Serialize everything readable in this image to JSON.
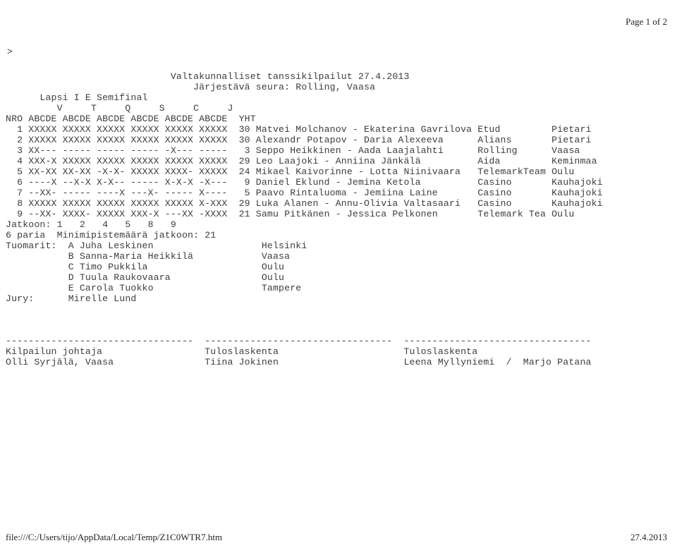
{
  "print_header": {
    "page_label": "Page 1 of 2"
  },
  "print_footer": {
    "file_path": "file:///C:/Users/tijo/AppData/Local/Temp/Z1C0WTR7.htm",
    "date": "27.4.2013"
  },
  "document": {
    "prompt_symbol": ">",
    "title_line_1": "Valtakunnalliset tanssikilpailut 27.4.2013",
    "title_line_2": "Järjestävä seura: Rolling, Vaasa",
    "event_line": "Lapsi I E Semifinal",
    "dance_header": "         V     T     Q     S     C     J",
    "column_header": "NRO ABCDE ABCDE ABCDE ABCDE ABCDE ABCDE  YHT",
    "rows": [
      {
        "nro": "1",
        "marks": "XXXXX XXXXX XXXXX XXXXX XXXXX XXXXX",
        "yht": "30",
        "couple": "Matvei Molchanov - Ekaterina Gavrilova",
        "club": "Etud",
        "city": "Pietari"
      },
      {
        "nro": "2",
        "marks": "XXXXX XXXXX XXXXX XXXXX XXXXX XXXXX",
        "yht": "30",
        "couple": "Alexandr Potapov - Daria Alexeeva",
        "club": "Alians",
        "city": "Pietari"
      },
      {
        "nro": "3",
        "marks": "XX--- ----- ----- ----- -X--- -----",
        "yht": "3",
        "couple": "Seppo Heikkinen - Aada Laajalahti",
        "club": "Rolling",
        "city": "Vaasa"
      },
      {
        "nro": "4",
        "marks": "XXX-X XXXXX XXXXX XXXXX XXXXX XXXXX",
        "yht": "29",
        "couple": "Leo Laajoki - Anniina Jänkälä",
        "club": "Aida",
        "city": "Keminmaa"
      },
      {
        "nro": "5",
        "marks": "XX-XX XX-XX -X-X- XXXXX XXXX- XXXXX",
        "yht": "24",
        "couple": "Mikael Kaivorinne - Lotta Niinivaara",
        "club": "TelemarkTeam",
        "city": "Oulu"
      },
      {
        "nro": "6",
        "marks": "----X --X-X X-X-- ----- X-X-X -X---",
        "yht": "9",
        "couple": "Daniel Eklund - Jemina Ketola",
        "club": "Casino",
        "city": "Kauhajoki"
      },
      {
        "nro": "7",
        "marks": "--XX- ----- ----X ---X- ----- X----",
        "yht": "5",
        "couple": "Paavo Rintaluoma - Jemiina Laine",
        "club": "Casino",
        "city": "Kauhajoki"
      },
      {
        "nro": "8",
        "marks": "XXXXX XXXXX XXXXX XXXXX XXXXX X-XXX",
        "yht": "29",
        "couple": "Luka Alanen - Annu-Olivia Valtasaari",
        "club": "Casino",
        "city": "Kauhajoki"
      },
      {
        "nro": "9",
        "marks": "--XX- XXXX- XXXXX XXX-X ---XX -XXXX",
        "yht": "21",
        "couple": "Samu Pitkänen - Jessica Pelkonen",
        "club": "Telemark Tea",
        "city": "Oulu"
      }
    ],
    "qualified_line": "Jatkoon: 1   2   4   5   8   9",
    "summary_line": "6 paria  Minimipistemäärä jatkoon: 21",
    "judges_label": "Tuomarit:",
    "judges": [
      {
        "letter": "A",
        "name": "Juha Leskinen",
        "city": "Helsinki"
      },
      {
        "letter": "B",
        "name": "Sanna-Maria Heikkilä",
        "city": "Vaasa"
      },
      {
        "letter": "C",
        "name": "Timo Pukkila",
        "city": "Oulu"
      },
      {
        "letter": "D",
        "name": "Tuula Raukovaara",
        "city": "Oulu"
      },
      {
        "letter": "E",
        "name": "Carola Tuokko",
        "city": "Tampere"
      }
    ],
    "jury_label": "Jury:",
    "jury_name": "Mirelle Lund",
    "signature_rule": "---------------------------------  ---------------------------------  ---------------------------------",
    "signatures": [
      {
        "role": "Kilpailun johtaja",
        "name": "Olli Syrjälä, Vaasa"
      },
      {
        "role": "Tuloslaskenta",
        "name": "Tiina Jokinen"
      },
      {
        "role": "Tuloslaskenta",
        "name": "Leena Myllyniemi  /  Marjo Patana"
      }
    ]
  }
}
